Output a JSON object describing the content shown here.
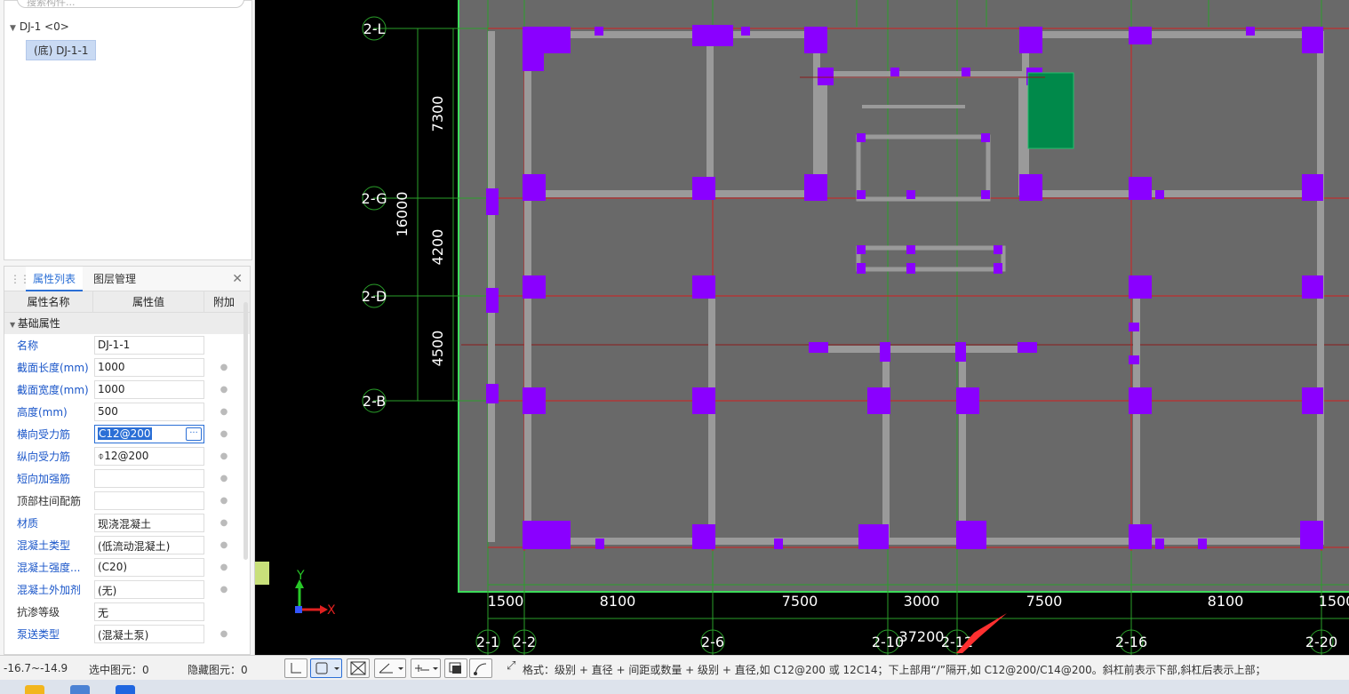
{
  "tree": {
    "search_placeholder": "搜索构件...",
    "node_label": "DJ-1 <0>",
    "child_label": "(底) DJ-1-1"
  },
  "props": {
    "tab_active": "属性列表",
    "tab_other": "图层管理",
    "col_name": "属性名称",
    "col_value": "属性值",
    "col_extra": "附加",
    "group": "基础属性",
    "rows": [
      {
        "name": "名称",
        "value": "DJ-1-1"
      },
      {
        "name": "截面长度(mm)",
        "value": "1000"
      },
      {
        "name": "截面宽度(mm)",
        "value": "1000"
      },
      {
        "name": "高度(mm)",
        "value": "500"
      },
      {
        "name": "横向受力筋",
        "value": "C12@200"
      },
      {
        "name": "纵向受力筋",
        "value": "⌽12@200"
      },
      {
        "name": "短向加强筋",
        "value": ""
      },
      {
        "name": "顶部柱间配筋",
        "value": ""
      },
      {
        "name": "材质",
        "value": "现浇混凝土"
      },
      {
        "name": "混凝土类型",
        "value": "(低流动混凝土)"
      },
      {
        "name": "混凝土强度...",
        "value": "(C20)"
      },
      {
        "name": "混凝土外加剂",
        "value": "(无)"
      },
      {
        "name": "抗渗等级",
        "value": "无"
      },
      {
        "name": "泵送类型",
        "value": "(混凝土泵)"
      }
    ]
  },
  "canvas": {
    "row_axes": [
      "2-L",
      "2-G",
      "2-D",
      "2-B"
    ],
    "row_dims": [
      "7300",
      "4200",
      "4500"
    ],
    "row_total": "16000",
    "col_axes": [
      "2-1",
      "2-2",
      "2-6",
      "2-10",
      "2-12",
      "2-16",
      "2-20"
    ],
    "col_dims": [
      "1500",
      "8100",
      "7500",
      "3000",
      "7500",
      "8100",
      "1500"
    ],
    "col_total": "37200",
    "axis_x": "X",
    "axis_y": "Y",
    "colors": {
      "slab": "#696969",
      "beam": "#9a9a9a",
      "pad": "#8a00ff",
      "axis": "#2aa02a",
      "redline": "#d21f1f",
      "boundary": "#3ddc5a",
      "green_block": "#00894a"
    }
  },
  "status": {
    "coords": "-16.7~-14.9",
    "selected": "选中图元：0",
    "hidden": "隐藏图元：0",
    "hint": "格式：级别 + 直径 + 间距或数量 + 级别 + 直径,如 C12@200 或 12C14；下上部用“/”隔开,如 C12@200/C14@200。斜杠前表示下部,斜杠后表示上部；"
  }
}
